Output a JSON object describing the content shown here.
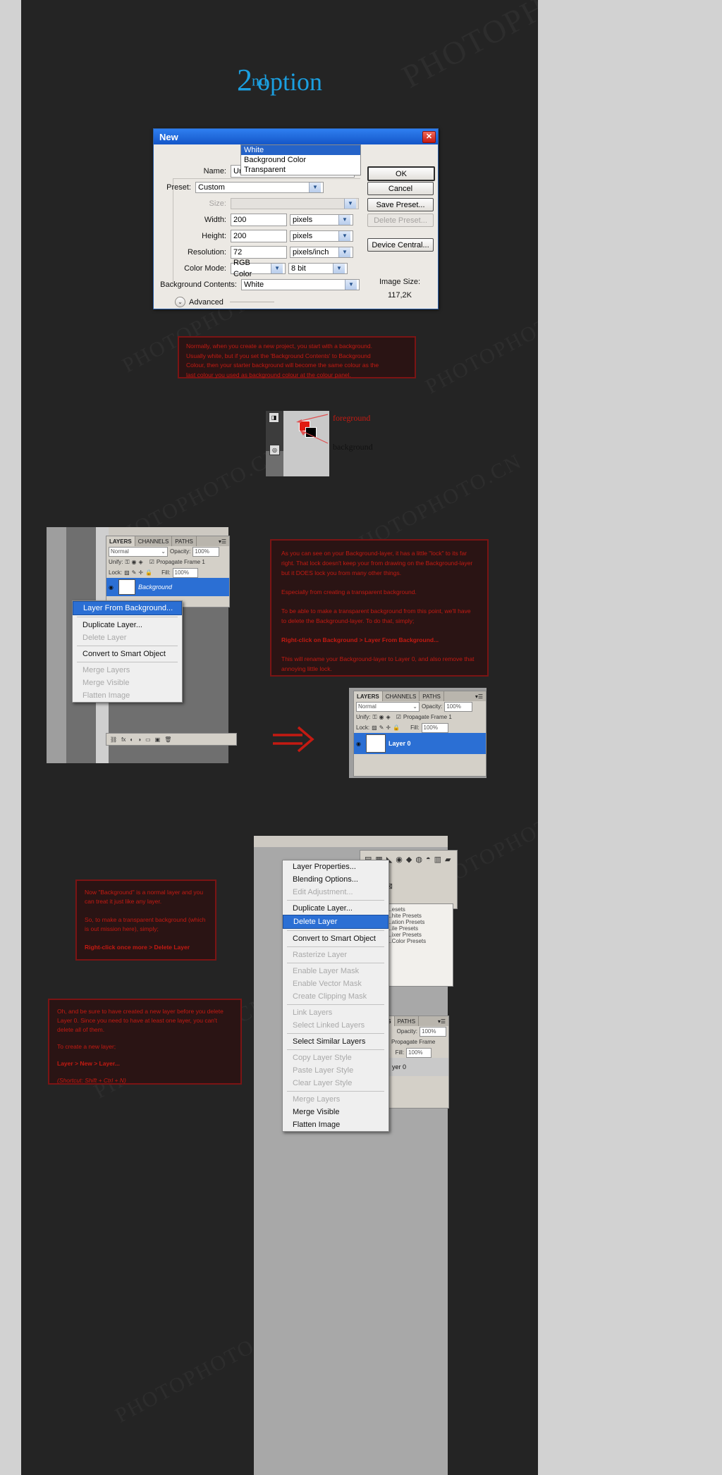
{
  "page": {
    "title_prefix": "2",
    "title_sup": "nd",
    "title_main": "option"
  },
  "watermarks": [
    "PHOTOPHOTO.CN",
    "PHOTOPHOTO.CN",
    "PHOTOPHOTO.CN",
    "PHOTOPHOTO.CN",
    "PHOTOPHOTO.CN",
    "PHOTOPHOTO.CN"
  ],
  "colors": {
    "accent_blue": "#1b9fe0",
    "annotation_red": "#c41a12",
    "annotation_bg": "#2a1414",
    "title_bar": "#1456c8",
    "selection_blue": "#2b6fd4",
    "canvas_bg": "#242424"
  },
  "new_dialog": {
    "title": "New",
    "close_icon": "close-icon",
    "fields": {
      "name_label": "Name:",
      "name_value": "Untitled-2",
      "preset_label": "Preset:",
      "preset_value": "Custom",
      "size_label": "Size:",
      "size_value": "",
      "width_label": "Width:",
      "width_value": "200",
      "width_unit": "pixels",
      "height_label": "Height:",
      "height_value": "200",
      "height_unit": "pixels",
      "resolution_label": "Resolution:",
      "resolution_value": "72",
      "resolution_unit": "pixels/inch",
      "color_mode_label": "Color Mode:",
      "color_mode_value": "RGB Color",
      "color_depth_value": "8 bit",
      "bg_contents_label": "Background Contents:",
      "bg_contents_value": "White",
      "advanced_label": "Advanced"
    },
    "bg_dropdown_options": [
      "White",
      "Background Color",
      "Transparent"
    ],
    "bg_dropdown_selected": "White",
    "buttons": {
      "ok": "OK",
      "cancel": "Cancel",
      "save_preset": "Save Preset...",
      "delete_preset": "Delete Preset...",
      "device_central": "Device Central..."
    },
    "image_size_label": "Image Size:",
    "image_size_value": "117,2K"
  },
  "annotation_1": {
    "lines": [
      "Normally, when you create a new project, you start with a background.",
      "Usually white, but if you set the 'Background Contents' to Background",
      "Colour, then your starter background will become the same colour as the",
      "last colour you used as background colour at the colour panel."
    ]
  },
  "swatch": {
    "foreground_label": "foreground",
    "background_label": "background"
  },
  "layers_panel_1": {
    "tabs": [
      "LAYERS",
      "CHANNELS",
      "PATHS"
    ],
    "blend_mode": "Normal",
    "opacity_label": "Opacity:",
    "opacity_value": "100%",
    "unify_label": "Unify:",
    "propagate_label": "Propagate Frame 1",
    "lock_label": "Lock:",
    "fill_label": "Fill:",
    "fill_value": "100%",
    "layer_name": "Background"
  },
  "context_menu_1": {
    "items": [
      {
        "label": "Layer From Background...",
        "state": "highlighted"
      },
      {
        "label": "sep",
        "state": "separator"
      },
      {
        "label": "Duplicate Layer...",
        "state": "normal"
      },
      {
        "label": "Delete Layer",
        "state": "disabled"
      },
      {
        "label": "sep",
        "state": "separator"
      },
      {
        "label": "Convert to Smart Object",
        "state": "normal"
      },
      {
        "label": "sep",
        "state": "separator"
      },
      {
        "label": "Merge Layers",
        "state": "disabled"
      },
      {
        "label": "Merge Visible",
        "state": "disabled"
      },
      {
        "label": "Flatten Image",
        "state": "disabled"
      }
    ]
  },
  "annotation_2": {
    "blocks": [
      "As you can see on your Background-layer, it has a little \"lock\" to its far right. That lock doesn't keep your from drawing on the Background-layer but it DOES lock you from many other things.",
      "Especially from creating a transparent background.",
      "To be able to make a transparent background from this point, we'll have to delete the Background-layer. To do that, simply;",
      "Right-click on Background > Layer From Background...",
      "This will rename your Background-layer to Layer 0, and also remove that annoying little lock."
    ]
  },
  "layers_panel_2": {
    "tabs": [
      "LAYERS",
      "CHANNELS",
      "PATHS"
    ],
    "blend_mode": "Normal",
    "opacity_label": "Opacity:",
    "opacity_value": "100%",
    "unify_label": "Unify:",
    "propagate_label": "Propagate Frame 1",
    "lock_label": "Lock:",
    "fill_label": "Fill:",
    "fill_value": "100%",
    "layer_name": "Layer 0"
  },
  "annotation_3": {
    "blocks": [
      "Now \"Background\" is a normal layer and you can treat it just like any layer.",
      "So, to make a transparent background (which is out mission here), simply;",
      "Right-click once more > Delete Layer"
    ]
  },
  "annotation_4": {
    "blocks": [
      "Oh, and be sure to have created a new layer before you delete Layer 0. Since you need to have at least one layer, you can't delete all of them.",
      "To create a new layer;",
      "Layer > New > Layer...",
      "(Shortcut: Shift + Ctrl + N)"
    ]
  },
  "context_menu_2": {
    "items": [
      {
        "label": "Layer Properties...",
        "state": "normal"
      },
      {
        "label": "Blending Options...",
        "state": "normal"
      },
      {
        "label": "Edit Adjustment...",
        "state": "disabled"
      },
      {
        "label": "sep",
        "state": "separator"
      },
      {
        "label": "Duplicate Layer...",
        "state": "normal"
      },
      {
        "label": "Delete Layer",
        "state": "highlighted"
      },
      {
        "label": "sep",
        "state": "separator"
      },
      {
        "label": "Convert to Smart Object",
        "state": "normal"
      },
      {
        "label": "sep",
        "state": "separator"
      },
      {
        "label": "Rasterize Layer",
        "state": "disabled"
      },
      {
        "label": "sep",
        "state": "separator"
      },
      {
        "label": "Enable Layer Mask",
        "state": "disabled"
      },
      {
        "label": "Enable Vector Mask",
        "state": "disabled"
      },
      {
        "label": "Create Clipping Mask",
        "state": "disabled"
      },
      {
        "label": "sep",
        "state": "separator"
      },
      {
        "label": "Link Layers",
        "state": "disabled"
      },
      {
        "label": "Select Linked Layers",
        "state": "disabled"
      },
      {
        "label": "sep",
        "state": "separator"
      },
      {
        "label": "Select Similar Layers",
        "state": "normal"
      },
      {
        "label": "sep",
        "state": "separator"
      },
      {
        "label": "Copy Layer Style",
        "state": "disabled"
      },
      {
        "label": "Paste Layer Style",
        "state": "disabled"
      },
      {
        "label": "Clear Layer Style",
        "state": "disabled"
      },
      {
        "label": "sep",
        "state": "separator"
      },
      {
        "label": "Merge Layers",
        "state": "disabled"
      },
      {
        "label": "Merge Visible",
        "state": "normal"
      },
      {
        "label": "Flatten Image",
        "state": "normal"
      }
    ]
  },
  "presets_list": {
    "items": [
      "...esets",
      "...hite Presets",
      "...ation Presets",
      "...ile Presets",
      "...ixer Presets",
      "...Color Presets"
    ]
  },
  "layers_panel_3": {
    "tabs": [
      "...ANNELS",
      "PATHS"
    ],
    "opacity_label": "Opacity:",
    "opacity_value": "100%",
    "propagate_label": "Propagate Frame",
    "fill_label": "Fill:",
    "fill_value": "100%",
    "layer_name": "yer 0"
  },
  "red_arrow": "→"
}
